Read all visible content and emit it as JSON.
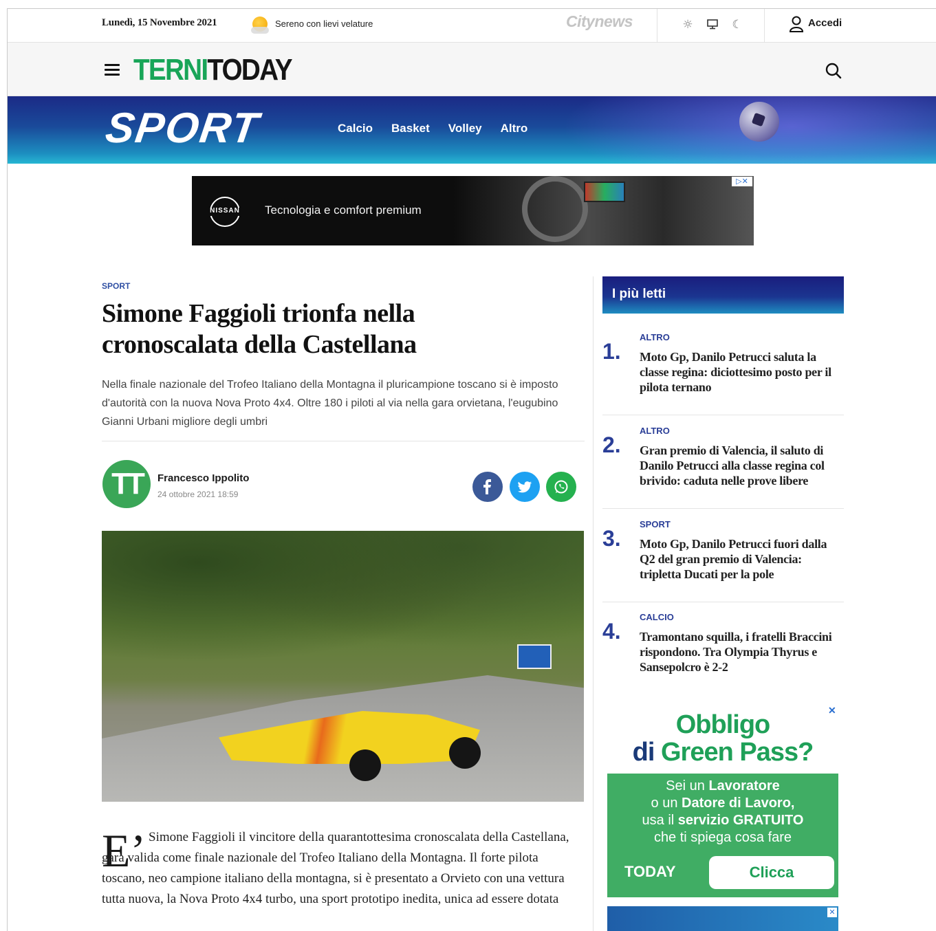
{
  "topbar": {
    "date": "Lunedì, 15 Novembre 2021",
    "weather": "Sereno con lievi velature",
    "network_logo": "Citynews",
    "login_label": "Accedi"
  },
  "header": {
    "logo_part1": "TERNI",
    "logo_part2": "TODAY"
  },
  "section": {
    "title": "SPORT",
    "nav": [
      "Calcio",
      "Basket",
      "Volley",
      "Altro"
    ]
  },
  "ad": {
    "brand": "NISSAN",
    "text": "Tecnologia e comfort premium"
  },
  "article": {
    "kicker": "SPORT",
    "headline": "Simone Faggioli trionfa nella cronoscalata della Castellana",
    "summary": "Nella finale nazionale del Trofeo Italiano della Montagna il pluricampione toscano si è imposto d'autorità con la nuova Nova Proto 4x4. Oltre 180 i piloti al via nella gara orvietana, l'eugubino Gianni Urbani migliore degli umbri",
    "author_initials": "TT",
    "author": "Francesco Ippolito",
    "published": "24 ottobre 2021 18:59",
    "dropcap": "E’",
    "body": "Simone Faggioli il vincitore della quarantottesima cronoscalata della Castellana, gara valida come finale nazionale del Trofeo Italiano della Montagna. Il forte pilota toscano, neo campione italiano della montagna, si è presentato a Orvieto con una vettura tutta nuova, la Nova Proto 4x4 turbo, una sport prototipo inedita, unica ad essere dotata"
  },
  "sidebar": {
    "popular_title": "I più letti",
    "items": [
      {
        "num": "1.",
        "category": "ALTRO",
        "title": "Moto Gp, Danilo Petrucci saluta la classe regina: diciottesimo posto per il pilota ternano"
      },
      {
        "num": "2.",
        "category": "ALTRO",
        "title": "Gran premio di Valencia, il saluto di Danilo Petrucci alla classe regina col brivido: caduta nelle prove libere"
      },
      {
        "num": "3.",
        "category": "SPORT",
        "title": "Moto Gp, Danilo Petrucci fuori dalla Q2 del gran premio di Valencia: tripletta Ducati per la pole"
      },
      {
        "num": "4.",
        "category": "CALCIO",
        "title": "Tramontano squilla, i fratelli Braccini rispondono. Tra Olympia Thyrus e Sansepolcro è 2-2"
      }
    ],
    "promo": {
      "title_line1": "Obbligo",
      "title_line2_a": "di ",
      "title_line2_b": "Green Pass?",
      "text_l1_a": "Sei un ",
      "text_l1_b": "Lavoratore",
      "text_l2_a": "o un ",
      "text_l2_b": "Datore di Lavoro,",
      "text_l3_a": "usa il ",
      "text_l3_b": "servizio GRATUITO",
      "text_l4": "che ti spiega cosa fare",
      "brand": "TODAY",
      "button": "Clicca"
    }
  },
  "colors": {
    "brand_green": "#18a558",
    "section_blue": "#2a3e97",
    "facebook": "#3b5998",
    "twitter": "#1da1f2",
    "whatsapp": "#25b14f"
  }
}
